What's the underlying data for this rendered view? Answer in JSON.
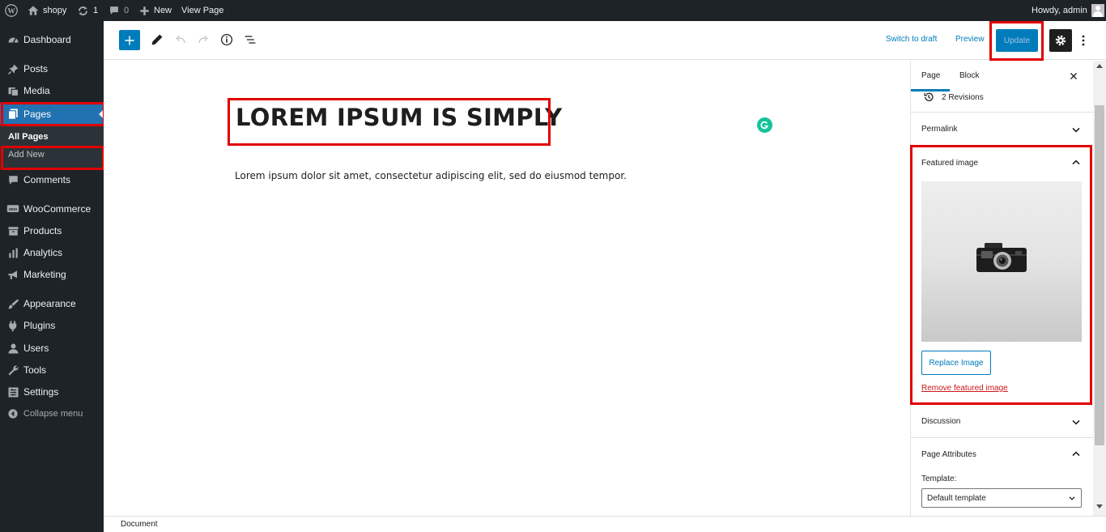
{
  "adminbar": {
    "site_name": "shopy",
    "updates_count": "1",
    "comments_count": "0",
    "new_label": "New",
    "view_page": "View Page",
    "greeting": "Howdy, admin"
  },
  "sidebar": {
    "items": [
      {
        "label": "Dashboard",
        "icon": "dashboard-icon"
      },
      {
        "label": "Posts",
        "icon": "pin-icon"
      },
      {
        "label": "Media",
        "icon": "media-icon"
      },
      {
        "label": "Pages",
        "icon": "pages-icon"
      },
      {
        "label": "Comments",
        "icon": "comment-icon"
      },
      {
        "label": "WooCommerce",
        "icon": "woo-icon"
      },
      {
        "label": "Products",
        "icon": "archive-icon"
      },
      {
        "label": "Analytics",
        "icon": "chart-bar-icon"
      },
      {
        "label": "Marketing",
        "icon": "megaphone-icon"
      },
      {
        "label": "Appearance",
        "icon": "brush-icon"
      },
      {
        "label": "Plugins",
        "icon": "plugin-icon"
      },
      {
        "label": "Users",
        "icon": "users-icon"
      },
      {
        "label": "Tools",
        "icon": "wrench-icon"
      },
      {
        "label": "Settings",
        "icon": "settings-icon"
      }
    ],
    "submenu": {
      "all_pages": "All Pages",
      "add_new": "Add New"
    },
    "collapse": "Collapse menu",
    "active_color": "#2271b1"
  },
  "toolbar": {
    "switch_to_draft": "Switch to draft",
    "preview": "Preview",
    "update": "Update",
    "accent": "#007cba"
  },
  "editor": {
    "title": "LOREM IPSUM IS SIMPLY",
    "paragraph": "Lorem ipsum dolor sit amet, consectetur adipiscing elit, sed do eiusmod tempor."
  },
  "panel": {
    "tabs": [
      "Page",
      "Block"
    ],
    "revisions": "2 Revisions",
    "permalink": "Permalink",
    "featured_image": "Featured image",
    "replace_image": "Replace Image",
    "remove_featured_image": "Remove featured image",
    "discussion": "Discussion",
    "page_attributes": "Page Attributes",
    "template_label": "Template:",
    "template_value": "Default template"
  },
  "status": {
    "document": "Document"
  },
  "colors": {
    "highlight": "#e00000",
    "admin_dark": "#1d2327"
  }
}
